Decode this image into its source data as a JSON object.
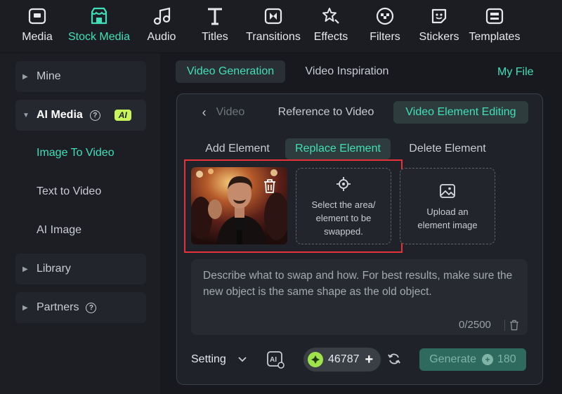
{
  "toolbar": {
    "items": [
      {
        "label": "Media",
        "icon": "media-icon"
      },
      {
        "label": "Stock Media",
        "icon": "stock-media-icon",
        "active": true
      },
      {
        "label": "Audio",
        "icon": "audio-icon"
      },
      {
        "label": "Titles",
        "icon": "titles-icon"
      },
      {
        "label": "Transitions",
        "icon": "transitions-icon"
      },
      {
        "label": "Effects",
        "icon": "effects-icon"
      },
      {
        "label": "Filters",
        "icon": "filters-icon"
      },
      {
        "label": "Stickers",
        "icon": "stickers-icon"
      },
      {
        "label": "Templates",
        "icon": "templates-icon"
      }
    ]
  },
  "sidebar": {
    "mine": "Mine",
    "ai_media": "AI Media",
    "ai_badge": "AI",
    "sub_items": [
      "Image To Video",
      "Text to Video",
      "AI Image"
    ],
    "library": "Library",
    "partners": "Partners"
  },
  "main_tabs": {
    "video_generation": "Video Generation",
    "video_inspiration": "Video Inspiration",
    "my_file": "My File"
  },
  "sub_tabs": {
    "back_video": "Video",
    "reference_to_video": "Reference to Video",
    "video_element_editing": "Video Element Editing"
  },
  "element_tabs": {
    "add": "Add Element",
    "replace": "Replace Element",
    "delete": "Delete Element"
  },
  "select_area": {
    "text": "Select the area/ element to be swapped."
  },
  "upload": {
    "text": "Upload an element image"
  },
  "prompt": {
    "placeholder": "Describe what to swap and how. For best results, make sure the new object is the same shape as the old object.",
    "count": "0/2500"
  },
  "footer": {
    "setting": "Setting",
    "credits": "46787",
    "generate": "Generate",
    "cost": "180"
  },
  "colors": {
    "accent": "#3fe0b8",
    "highlight_frame": "#e53339",
    "ai_badge": "#c8f55a"
  }
}
